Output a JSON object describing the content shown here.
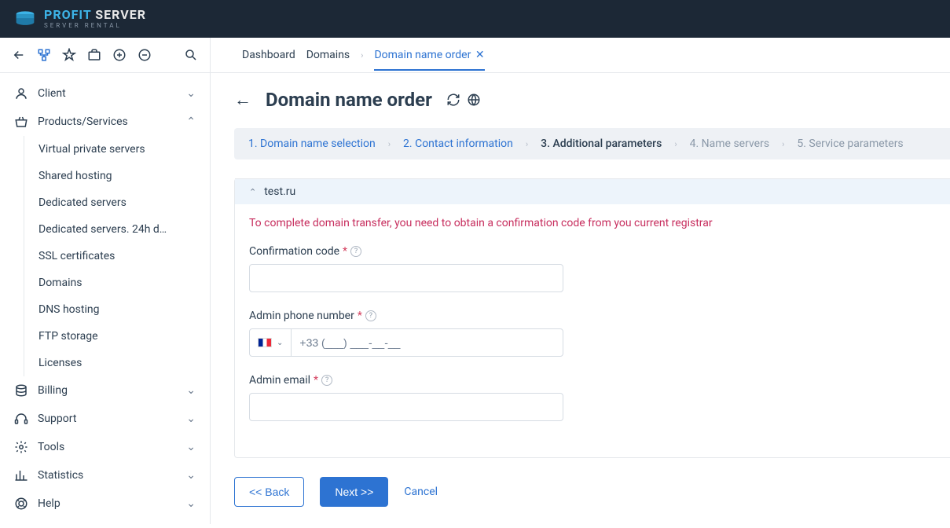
{
  "brand": {
    "name1": "PROFIT",
    "name2": " SERVER",
    "tagline": "SERVER RENTAL"
  },
  "breadcrumb": {
    "items": [
      "Dashboard",
      "Domains",
      "Domain name order"
    ],
    "active_index": 2
  },
  "sidebar": {
    "client": "Client",
    "products": "Products/Services",
    "sub": [
      "Virtual private servers",
      "Shared hosting",
      "Dedicated servers",
      "Dedicated servers. 24h d…",
      "SSL certificates",
      "Domains",
      "DNS hosting",
      "FTP storage",
      "Licenses"
    ],
    "billing": "Billing",
    "support": "Support",
    "tools": "Tools",
    "statistics": "Statistics",
    "help": "Help"
  },
  "page": {
    "title": "Domain name order",
    "steps": [
      "1. Domain name selection",
      "2. Contact information",
      "3. Additional parameters",
      "4. Name servers",
      "5. Service parameters"
    ],
    "current_step": 2,
    "domain": "test.ru",
    "warning": "To complete domain transfer, you need to obtain a confirmation code from you current registrar",
    "fields": {
      "code_label": "Confirmation code",
      "phone_label": "Admin phone number ",
      "phone_value": "+33 (___) ___-__-__",
      "email_label": "Admin email "
    },
    "actions": {
      "back": "<< Back",
      "next": "Next >>",
      "cancel": "Cancel"
    }
  }
}
